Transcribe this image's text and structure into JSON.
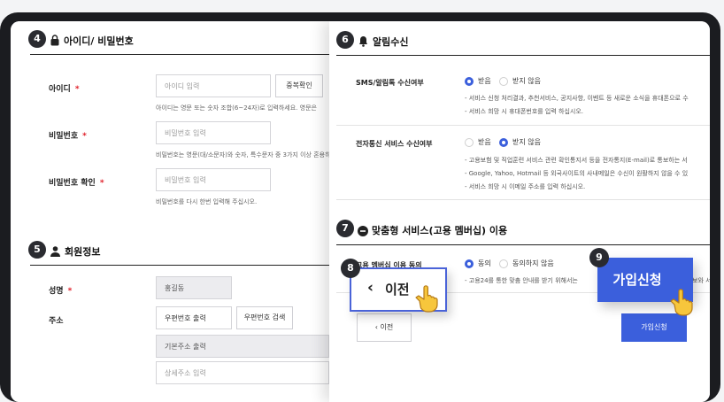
{
  "sections": {
    "account": {
      "number": "4",
      "title": "아이디/ 비밀번호"
    },
    "member": {
      "number": "5",
      "title": "회원정보"
    },
    "notify": {
      "number": "6",
      "title": "알림수신"
    },
    "custom": {
      "number": "7",
      "title": "맞춤형 서비스(고용 멤버십) 이용"
    }
  },
  "account": {
    "id_label": "아이디",
    "id_placeholder": "아이디 입력",
    "dup_check": "중복확인",
    "id_help": "아이디는 영문 또는 숫자 조합(6~24자)로 입력하세요. 영문은",
    "pw_label": "비밀번호",
    "pw_placeholder": "비밀번호 입력",
    "pw_help": "비밀번호는 영문(대/소문자)와 숫자, 특수문자 중 3가지 이상 혼용하",
    "pw2_label": "비밀번호 확인",
    "pw2_placeholder": "비밀번호 입력",
    "pw2_help": "비밀번호를 다시 한번 입력해 주십시오."
  },
  "member": {
    "name_label": "성명",
    "name_value": "홍길동",
    "addr_label": "주소",
    "zip_value": "우편번호 출력",
    "zip_search": "우편번호 검색",
    "base_addr": "기본주소 출력",
    "detail_placeholder": "상세주소 입력"
  },
  "notify": {
    "sms_label": "SMS/알림톡 수신여부",
    "sms_options": [
      "받음",
      "받지 않음"
    ],
    "sms_bullets": [
      "- 서비스 신청 처리결과, 추천서비스, 공지사항, 이벤트 등 새로운 소식을 휴대폰으로 수",
      "- 서비스 희망 시 휴대폰번호를 입력 하십시오."
    ],
    "email_label": "전자통신 서비스 수신여부",
    "email_options": [
      "받음",
      "받지 않음"
    ],
    "email_bullets": [
      "- 고용보험 및 직업훈련 서비스 관련 확인통지서 등을 전자통지(E-mail)로 통보하는 서",
      "- Google, Yahoo, Hotmail 등 외국사이트의 사내메일은 수신이 원활하지 않을 수 있",
      "- 서비스 희망 시 이메일 주소를 입력 하십시오."
    ]
  },
  "custom": {
    "consent_label": "고용 멤버십 이용 동의",
    "options": [
      "동의",
      "동의하지 않음"
    ],
    "bullet": "- 고용24를 통한 맞춤 안내를 받기 위해서는",
    "bullet_tail": "보와 서"
  },
  "callouts": {
    "prev": {
      "number": "8",
      "label": "이전"
    },
    "signup": {
      "number": "9",
      "label": "가입신청"
    }
  },
  "buttons": {
    "prev_small": "이전",
    "signup_small": "가입신청"
  },
  "colors": {
    "primary": "#3b5fdc",
    "required": "#e0202a",
    "badge": "#2a2b30",
    "device": "#1b1c20"
  }
}
